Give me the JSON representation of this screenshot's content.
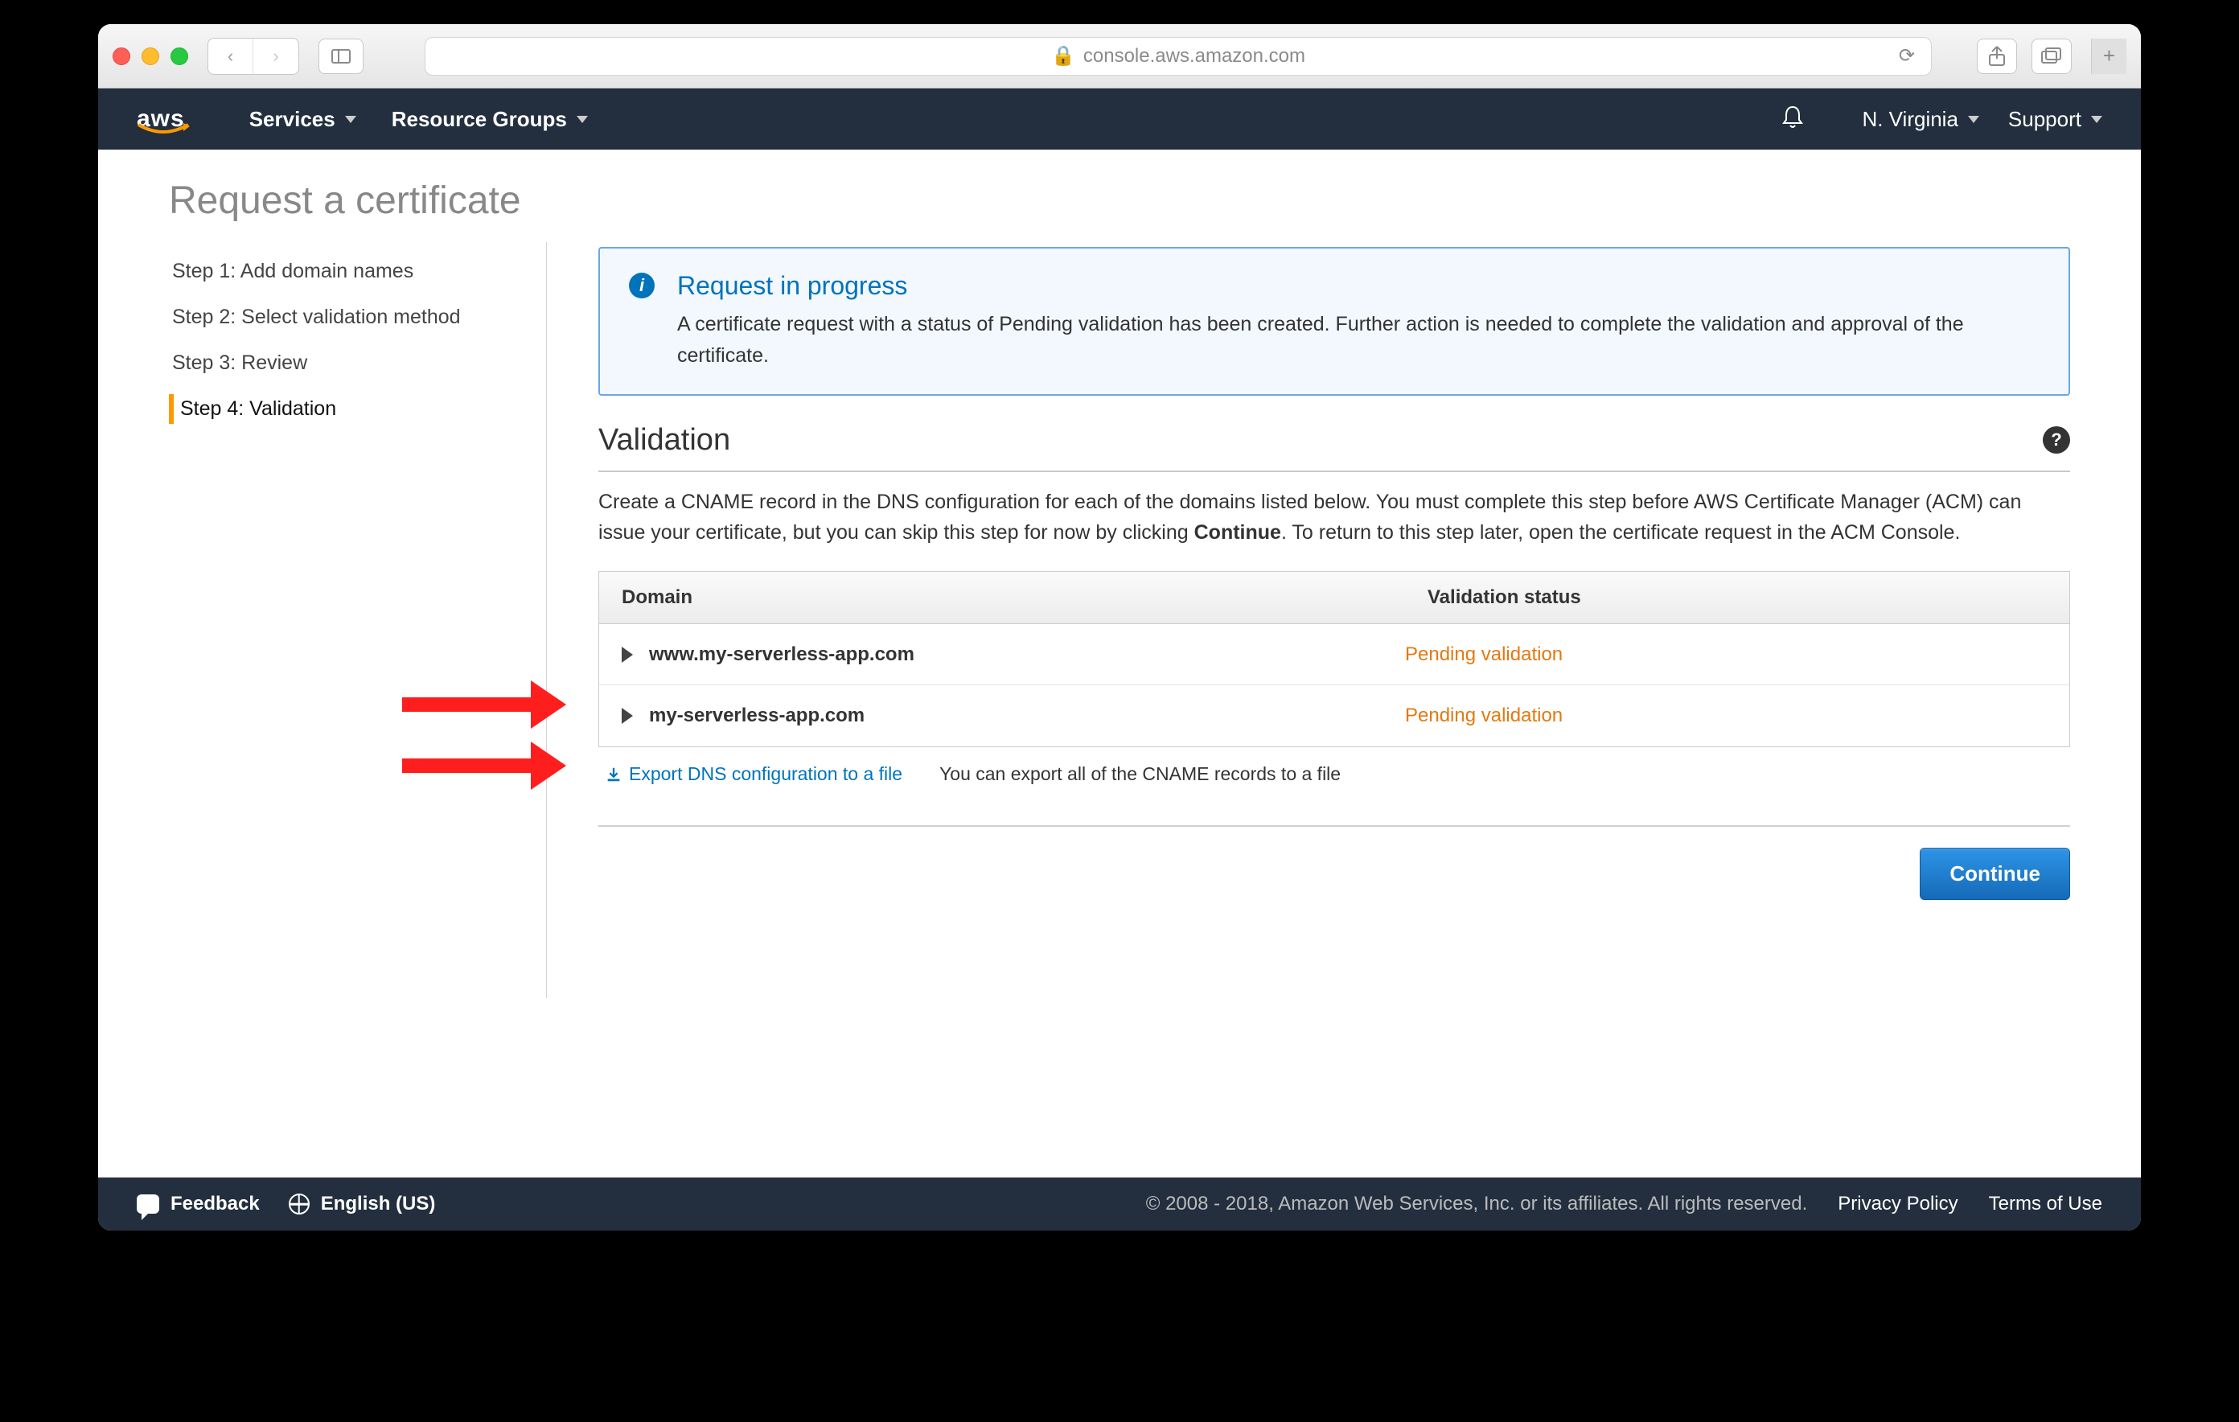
{
  "browser": {
    "url_host": "console.aws.amazon.com",
    "lock_icon": "lock-icon"
  },
  "header": {
    "logo": "aws",
    "services": "Services",
    "resource_groups": "Resource Groups",
    "region": "N. Virginia",
    "support": "Support"
  },
  "page": {
    "title": "Request a certificate"
  },
  "steps": [
    {
      "label": "Step 1: Add domain names",
      "active": false
    },
    {
      "label": "Step 2: Select validation method",
      "active": false
    },
    {
      "label": "Step 3: Review",
      "active": false
    },
    {
      "label": "Step 4: Validation",
      "active": true
    }
  ],
  "infobox": {
    "title": "Request in progress",
    "body": "A certificate request with a status of Pending validation has been created. Further action is needed to complete the validation and approval of the certificate."
  },
  "section": {
    "title": "Validation",
    "desc_pre": "Create a CNAME record in the DNS configuration for each of the domains listed below. You must complete this step before AWS Certificate Manager (ACM) can issue your certificate, but you can skip this step for now by clicking ",
    "desc_bold": "Continue",
    "desc_post": ". To return to this step later, open the certificate request in the ACM Console."
  },
  "table": {
    "col_domain": "Domain",
    "col_status": "Validation status",
    "rows": [
      {
        "domain": "www.my-serverless-app.com",
        "status": "Pending validation"
      },
      {
        "domain": "my-serverless-app.com",
        "status": "Pending validation"
      }
    ]
  },
  "export": {
    "link": "Export DNS configuration to a file",
    "note": "You can export all of the CNAME records to a file"
  },
  "buttons": {
    "continue": "Continue"
  },
  "footer": {
    "feedback": "Feedback",
    "language": "English (US)",
    "copyright": "© 2008 - 2018, Amazon Web Services, Inc. or its affiliates. All rights reserved.",
    "privacy": "Privacy Policy",
    "terms": "Terms of Use"
  }
}
